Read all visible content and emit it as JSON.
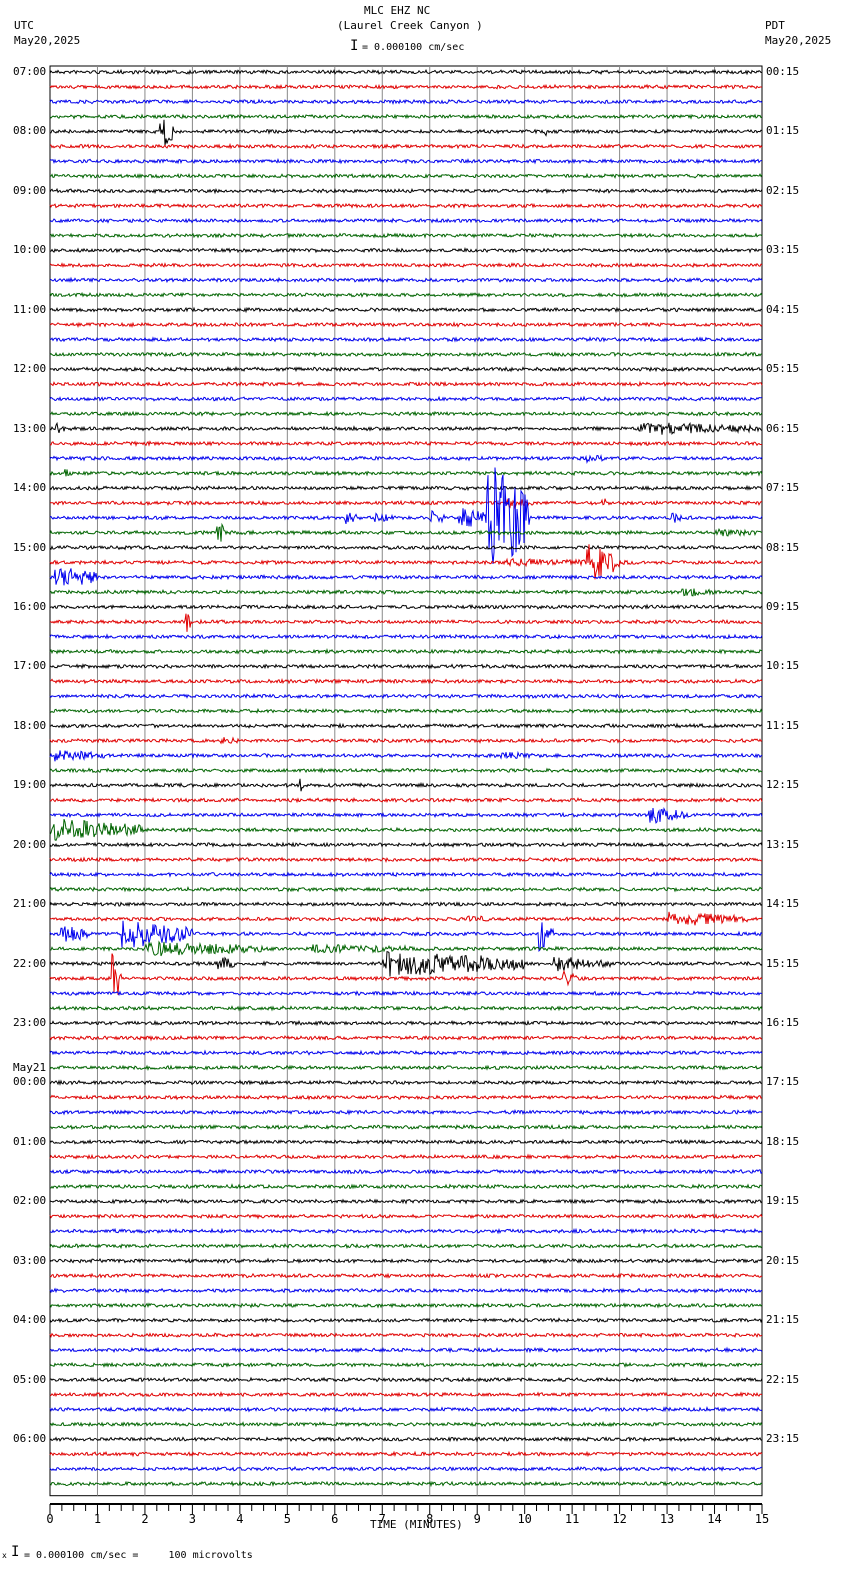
{
  "header": {
    "station": "MLC EHZ NC",
    "location": "(Laurel Creek Canyon )",
    "left_tz": "UTC",
    "left_date": "May20,2025",
    "right_tz": "PDT",
    "right_date": "May20,2025",
    "scale": "= 0.000100 cm/sec"
  },
  "footer": {
    "scale": "= 0.000100 cm/sec =     100 microvolts",
    "prefix": "x"
  },
  "chart_data": {
    "type": "line",
    "title": "MLC EHZ NC (Laurel Creek Canyon )",
    "xlabel": "TIME (MINUTES)",
    "xlim": [
      0,
      15
    ],
    "x_ticks": [
      "0",
      "1",
      "2",
      "3",
      "4",
      "5",
      "6",
      "7",
      "8",
      "9",
      "10",
      "11",
      "12",
      "13",
      "14",
      "15"
    ],
    "traces_per_hour": 4,
    "trace_colors": [
      "#000000",
      "#e00000",
      "#0000ee",
      "#006400"
    ],
    "left_labels": [
      "07:00",
      "08:00",
      "09:00",
      "10:00",
      "11:00",
      "12:00",
      "13:00",
      "14:00",
      "15:00",
      "16:00",
      "17:00",
      "18:00",
      "19:00",
      "20:00",
      "21:00",
      "22:00",
      "23:00",
      "00:00",
      "01:00",
      "02:00",
      "03:00",
      "04:00",
      "05:00",
      "06:00"
    ],
    "date_change": {
      "hour_index": 17,
      "label": "May21"
    },
    "right_labels": [
      "00:15",
      "01:15",
      "02:15",
      "03:15",
      "04:15",
      "05:15",
      "06:15",
      "07:15",
      "08:15",
      "09:15",
      "10:15",
      "11:15",
      "12:15",
      "13:15",
      "14:15",
      "15:15",
      "16:15",
      "17:15",
      "18:15",
      "19:15",
      "20:15",
      "21:15",
      "22:15",
      "23:15"
    ],
    "events": [
      {
        "trace": 4,
        "start": 2.3,
        "end": 2.6,
        "amp": 20
      },
      {
        "trace": 4,
        "start": 10.4,
        "end": 10.5,
        "amp": 6
      },
      {
        "trace": 24,
        "start": 0.05,
        "end": 0.3,
        "amp": 8
      },
      {
        "trace": 24,
        "start": 12.4,
        "end": 15,
        "amp": 7
      },
      {
        "trace": 26,
        "start": 11.3,
        "end": 11.8,
        "amp": 4
      },
      {
        "trace": 27,
        "start": 0.3,
        "end": 0.5,
        "amp": 5
      },
      {
        "trace": 29,
        "start": 9.6,
        "end": 10.2,
        "amp": 6
      },
      {
        "trace": 29,
        "start": 11.6,
        "end": 11.8,
        "amp": 6
      },
      {
        "trace": 30,
        "start": 9.2,
        "end": 10.1,
        "amp": 60
      },
      {
        "trace": 30,
        "start": 8.6,
        "end": 9.2,
        "amp": 12
      },
      {
        "trace": 30,
        "start": 6.2,
        "end": 6.5,
        "amp": 7
      },
      {
        "trace": 30,
        "start": 6.8,
        "end": 7.3,
        "amp": 5
      },
      {
        "trace": 30,
        "start": 8.0,
        "end": 8.4,
        "amp": 8
      },
      {
        "trace": 30,
        "start": 13.1,
        "end": 13.3,
        "amp": 8
      },
      {
        "trace": 31,
        "start": 3.5,
        "end": 3.7,
        "amp": 15
      },
      {
        "trace": 31,
        "start": 14,
        "end": 15,
        "amp": 4
      },
      {
        "trace": 33,
        "start": 11.3,
        "end": 12.0,
        "amp": 22
      },
      {
        "trace": 33,
        "start": 9.6,
        "end": 12.5,
        "amp": 4
      },
      {
        "trace": 34,
        "start": 0.1,
        "end": 1.0,
        "amp": 12
      },
      {
        "trace": 35,
        "start": 13.3,
        "end": 14.0,
        "amp": 5
      },
      {
        "trace": 37,
        "start": 2.85,
        "end": 2.95,
        "amp": 16
      },
      {
        "trace": 45,
        "start": 3.6,
        "end": 4.1,
        "amp": 4
      },
      {
        "trace": 46,
        "start": 0.1,
        "end": 1.2,
        "amp": 6
      },
      {
        "trace": 46,
        "start": 9.5,
        "end": 10.3,
        "amp": 4
      },
      {
        "trace": 48,
        "start": 5.25,
        "end": 5.35,
        "amp": 8
      },
      {
        "trace": 50,
        "start": 12.6,
        "end": 13.5,
        "amp": 9
      },
      {
        "trace": 51,
        "start": 0,
        "end": 2.0,
        "amp": 12
      },
      {
        "trace": 57,
        "start": 13.0,
        "end": 14.7,
        "amp": 8
      },
      {
        "trace": 57,
        "start": 8.8,
        "end": 9.4,
        "amp": 4
      },
      {
        "trace": 58,
        "start": 1.5,
        "end": 3.0,
        "amp": 15
      },
      {
        "trace": 58,
        "start": 10.3,
        "end": 10.6,
        "amp": 20
      },
      {
        "trace": 58,
        "start": 0.2,
        "end": 0.8,
        "amp": 10
      },
      {
        "trace": 59,
        "start": 2.0,
        "end": 4.5,
        "amp": 8
      },
      {
        "trace": 59,
        "start": 5.5,
        "end": 8.0,
        "amp": 5
      },
      {
        "trace": 60,
        "start": 7.0,
        "end": 10.0,
        "amp": 14
      },
      {
        "trace": 60,
        "start": 10.6,
        "end": 11.8,
        "amp": 8
      },
      {
        "trace": 60,
        "start": 3.5,
        "end": 3.9,
        "amp": 8
      },
      {
        "trace": 61,
        "start": 1.3,
        "end": 1.5,
        "amp": 28
      },
      {
        "trace": 61,
        "start": 10.8,
        "end": 11.1,
        "amp": 8
      }
    ]
  }
}
